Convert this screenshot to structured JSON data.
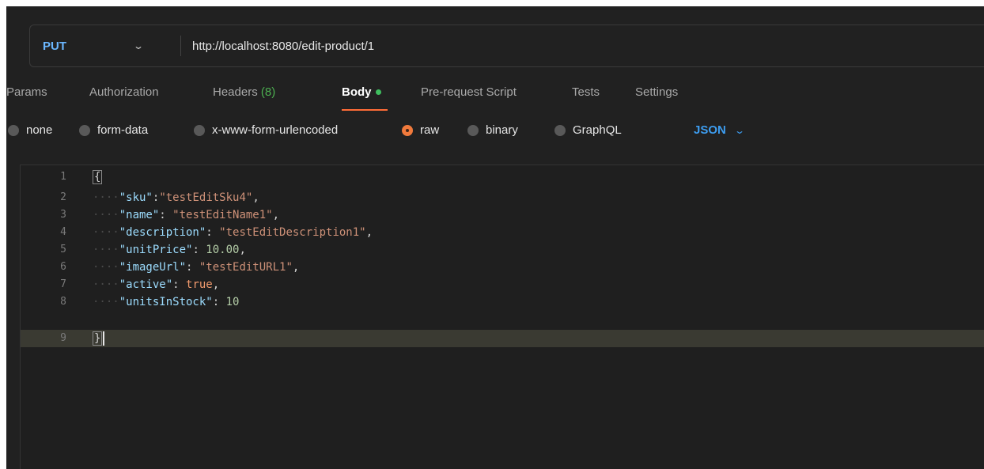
{
  "request": {
    "method": "PUT",
    "url": "http://localhost:8080/edit-product/1"
  },
  "tabs": [
    {
      "label": "Params"
    },
    {
      "label": "Authorization"
    },
    {
      "label": "Headers",
      "count": "(8)"
    },
    {
      "label": "Body",
      "active": true
    },
    {
      "label": "Pre-request Script"
    },
    {
      "label": "Tests"
    },
    {
      "label": "Settings"
    }
  ],
  "body_options": [
    {
      "label": "none"
    },
    {
      "label": "form-data"
    },
    {
      "label": "x-www-form-urlencoded"
    },
    {
      "label": "raw",
      "selected": true
    },
    {
      "label": "binary"
    },
    {
      "label": "GraphQL"
    }
  ],
  "language": "JSON",
  "editor": {
    "lines": [
      {
        "n": "1",
        "brace_open": "{"
      },
      {
        "n": "2",
        "key": "\"sku\"",
        "sep": ":",
        "value": "\"testEditSku4\"",
        "type": "str",
        "comma": ","
      },
      {
        "n": "3",
        "key": "\"name\"",
        "sep": ": ",
        "value": "\"testEditName1\"",
        "type": "str",
        "comma": ","
      },
      {
        "n": "4",
        "key": "\"description\"",
        "sep": ": ",
        "value": "\"testEditDescription1\"",
        "type": "str",
        "comma": ","
      },
      {
        "n": "5",
        "key": "\"unitPrice\"",
        "sep": ": ",
        "value": "10.00",
        "type": "num",
        "comma": ","
      },
      {
        "n": "6",
        "key": "\"imageUrl\"",
        "sep": ": ",
        "value": "\"testEditURL1\"",
        "type": "str",
        "comma": ","
      },
      {
        "n": "7",
        "key": "\"active\"",
        "sep": ": ",
        "value": "true",
        "type": "kw",
        "comma": ","
      },
      {
        "n": "8",
        "key": "\"unitsInStock\"",
        "sep": ": ",
        "value": "10",
        "type": "num",
        "comma": ""
      },
      {
        "n": "9",
        "brace_close": "}"
      }
    ]
  },
  "colors": {
    "accent": "#ff6c37",
    "method": "#6bb7ff",
    "language": "#3d9df0",
    "header_count": "#4caf50"
  }
}
